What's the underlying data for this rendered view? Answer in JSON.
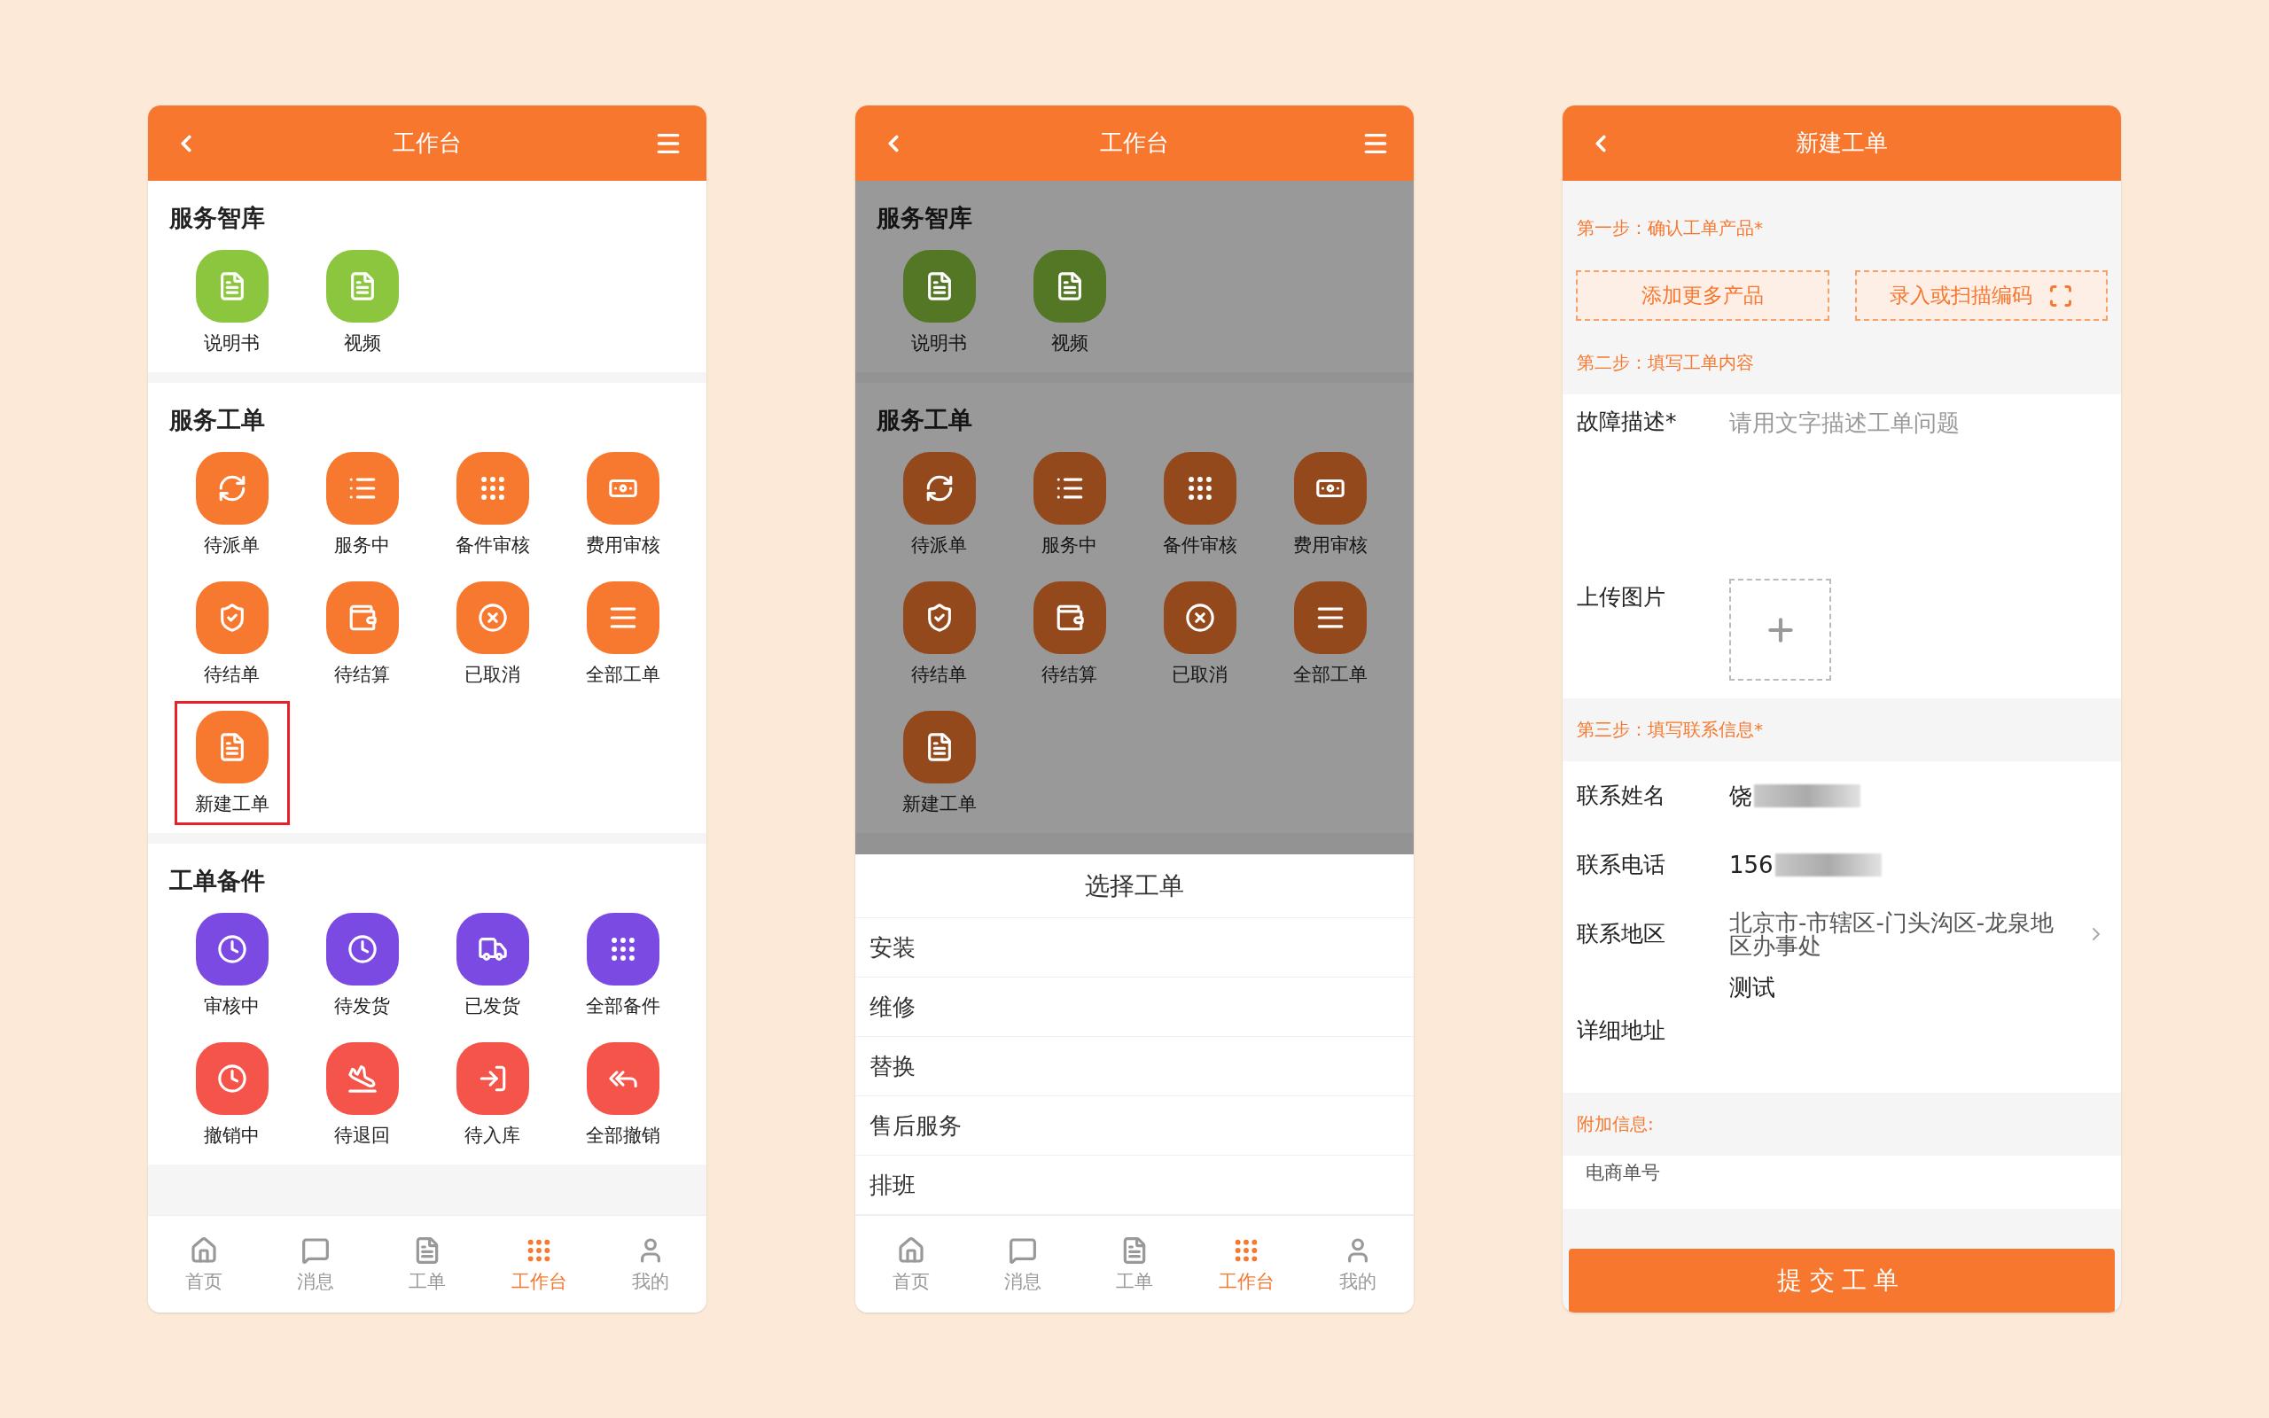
{
  "screens": [
    {
      "kind": "workbench",
      "title": "工作台",
      "sections": [
        {
          "title": "服务智库",
          "items": [
            {
              "label": "说明书",
              "color": "#8cc63f",
              "highlighted": false
            },
            {
              "label": "视频",
              "color": "#8cc63f",
              "highlighted": false
            }
          ]
        },
        {
          "title": "服务工单",
          "items": [
            {
              "label": "待派单",
              "color": "#f7792f",
              "highlighted": false
            },
            {
              "label": "服务中",
              "color": "#f7792f",
              "highlighted": false
            },
            {
              "label": "备件审核",
              "color": "#f7792f",
              "highlighted": false
            },
            {
              "label": "费用审核",
              "color": "#f7792f",
              "highlighted": false
            },
            {
              "label": "待结单",
              "color": "#f7792f",
              "highlighted": false
            },
            {
              "label": "待结算",
              "color": "#f7792f",
              "highlighted": false
            },
            {
              "label": "已取消",
              "color": "#f7792f",
              "highlighted": false
            },
            {
              "label": "全部工单",
              "color": "#f7792f",
              "highlighted": false
            },
            {
              "label": "新建工单",
              "color": "#f7792f",
              "highlighted": true
            }
          ]
        },
        {
          "title": "工单备件",
          "items": [
            {
              "label": "审核中",
              "color": "#7b4ae2",
              "highlighted": false
            },
            {
              "label": "待发货",
              "color": "#7b4ae2",
              "highlighted": false
            },
            {
              "label": "已发货",
              "color": "#7b4ae2",
              "highlighted": false
            },
            {
              "label": "全部备件",
              "color": "#7b4ae2",
              "highlighted": false
            },
            {
              "label": "撤销中",
              "color": "#f5544a",
              "highlighted": false
            },
            {
              "label": "待退回",
              "color": "#f5544a",
              "highlighted": false
            },
            {
              "label": "待入库",
              "color": "#f5544a",
              "highlighted": false
            },
            {
              "label": "全部撤销",
              "color": "#f5544a",
              "highlighted": false
            }
          ]
        }
      ],
      "tabs": [
        {
          "label": "首页",
          "selected": false
        },
        {
          "label": "消息",
          "selected": false
        },
        {
          "label": "工单",
          "selected": false
        },
        {
          "label": "工作台",
          "selected": true
        },
        {
          "label": "我的",
          "selected": false
        }
      ]
    },
    {
      "kind": "workbench",
      "title": "工作台",
      "sections": [
        {
          "title": "服务智库",
          "items": [
            {
              "label": "说明书",
              "color": "#547726",
              "highlighted": false
            },
            {
              "label": "视频",
              "color": "#547726",
              "highlighted": false
            }
          ]
        },
        {
          "title": "服务工单",
          "items": [
            {
              "label": "待派单",
              "color": "#94491c",
              "highlighted": false
            },
            {
              "label": "服务中",
              "color": "#94491c",
              "highlighted": false
            },
            {
              "label": "备件审核",
              "color": "#94491c",
              "highlighted": false
            },
            {
              "label": "费用审核",
              "color": "#94491c",
              "highlighted": false
            },
            {
              "label": "待结单",
              "color": "#94491c",
              "highlighted": false
            },
            {
              "label": "待结算",
              "color": "#94491c",
              "highlighted": false
            },
            {
              "label": "已取消",
              "color": "#94491c",
              "highlighted": false
            },
            {
              "label": "全部工单",
              "color": "#94491c",
              "highlighted": false
            },
            {
              "label": "新建工单",
              "color": "#94491c",
              "highlighted": false
            }
          ]
        }
      ],
      "sheet": {
        "title": "选择工单",
        "options": [
          "安装",
          "维修",
          "替换",
          "售后服务",
          "排班"
        ]
      },
      "tabs": [
        {
          "label": "首页",
          "selected": false
        },
        {
          "label": "消息",
          "selected": false
        },
        {
          "label": "工单",
          "selected": false
        },
        {
          "label": "工作台",
          "selected": true
        },
        {
          "label": "我的",
          "selected": false
        }
      ]
    },
    {
      "kind": "form",
      "title": "新建工单",
      "blocks": [
        {
          "kind": "step",
          "text": "第一步：确认工单产品*"
        },
        {
          "kind": "buttons",
          "buttons": [
            {
              "label": "添加更多产品",
              "scan": false
            },
            {
              "label": "录入或扫描编码",
              "scan": true
            }
          ]
        },
        {
          "kind": "step",
          "text": "第二步：填写工单内容"
        },
        {
          "kind": "group",
          "fields": [
            {
              "kind": "textarea",
              "label": "故障描述*",
              "placeholder": "请用文字描述工单问题"
            },
            {
              "kind": "upload",
              "label": "上传图片"
            }
          ]
        },
        {
          "kind": "step",
          "text": "第三步：填写联系信息*"
        },
        {
          "kind": "group",
          "fields": [
            {
              "kind": "text",
              "label": "联系姓名",
              "value": "饶",
              "redacted": true
            },
            {
              "kind": "text",
              "label": "联系电话",
              "value": "156",
              "redacted": true
            },
            {
              "kind": "select",
              "label": "联系地区",
              "value": "北京市-市辖区-门头沟区-龙泉地区办事处"
            },
            {
              "kind": "textarea",
              "label": "详细地址",
              "value": "测试"
            }
          ]
        },
        {
          "kind": "step",
          "text": "附加信息:"
        },
        {
          "kind": "group",
          "fields": [
            {
              "kind": "small",
              "label": "电商单号"
            }
          ]
        }
      ],
      "submit": "提交工单"
    }
  ]
}
